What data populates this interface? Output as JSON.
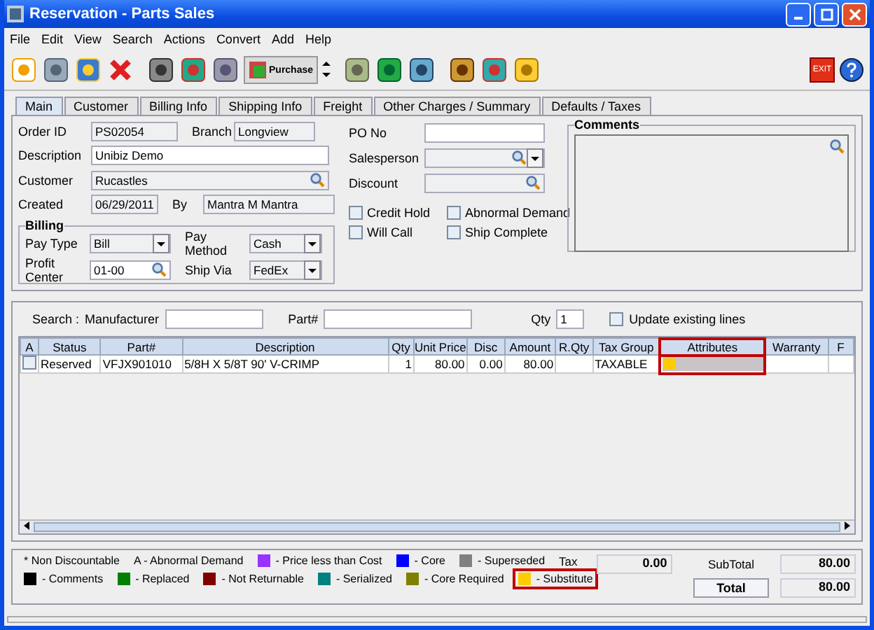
{
  "window": {
    "title": "Reservation - Parts Sales"
  },
  "menu": [
    "File",
    "Edit",
    "View",
    "Search",
    "Actions",
    "Convert",
    "Add",
    "Help"
  ],
  "toolbar": {
    "purchase_label": "Purchase",
    "exit_label": "EXIT"
  },
  "tabs": [
    {
      "label": "Main",
      "selected": true
    },
    {
      "label": "Customer",
      "selected": false
    },
    {
      "label": "Billing Info",
      "selected": false
    },
    {
      "label": "Shipping Info",
      "selected": false
    },
    {
      "label": "Freight",
      "selected": false
    },
    {
      "label": "Other Charges / Summary",
      "selected": false
    },
    {
      "label": "Defaults / Taxes",
      "selected": false
    }
  ],
  "order": {
    "order_id": {
      "label": "Order ID",
      "value": "PS02054"
    },
    "branch": {
      "label": "Branch",
      "value": "Longview"
    },
    "description": {
      "label": "Description",
      "value": "Unibiz Demo"
    },
    "customer": {
      "label": "Customer",
      "value": "Rucastles"
    },
    "created": {
      "label": "Created",
      "value": "06/29/2011"
    },
    "by": {
      "label": "By",
      "value": "Mantra M Mantra"
    },
    "po_no": {
      "label": "PO No"
    },
    "salesperson": {
      "label": "Salesperson"
    },
    "discount": {
      "label": "Discount"
    }
  },
  "flags": [
    {
      "label": "Credit Hold",
      "checked": false
    },
    {
      "label": "Abnormal Demand",
      "checked": false
    },
    {
      "label": "Will Call",
      "checked": false
    },
    {
      "label": "Ship Complete",
      "checked": false
    }
  ],
  "billing": {
    "title": "Billing",
    "pay_type": {
      "label": "Pay Type",
      "value": "Bill"
    },
    "pay_method": {
      "label": "Pay Method",
      "value": "Cash"
    },
    "profit_center": {
      "label": "Profit Center",
      "value": "01-00"
    },
    "ship_via": {
      "label": "Ship Via",
      "value": "FedEx"
    }
  },
  "comments": {
    "title": "Comments"
  },
  "search": {
    "label": "Search :",
    "manufacturer_label": "Manufacturer",
    "part_label": "Part#",
    "qty_label": "Qty",
    "qty_value": "1",
    "update_label": "Update existing lines",
    "update_checked": false
  },
  "table": {
    "columns": [
      {
        "label": "A",
        "highlighted": false
      },
      {
        "label": "Status",
        "highlighted": false
      },
      {
        "label": "Part#",
        "highlighted": false
      },
      {
        "label": "Description",
        "highlighted": false
      },
      {
        "label": "Qty",
        "highlighted": false
      },
      {
        "label": "Unit Price",
        "highlighted": false
      },
      {
        "label": "Disc",
        "highlighted": false
      },
      {
        "label": "Amount",
        "highlighted": false
      },
      {
        "label": "R.Qty",
        "highlighted": false
      },
      {
        "label": "Tax Group",
        "highlighted": false
      },
      {
        "label": "Attributes",
        "highlighted": true
      },
      {
        "label": "Warranty",
        "highlighted": false
      },
      {
        "label": "F",
        "highlighted": false
      }
    ],
    "rows": [
      {
        "checked": false,
        "status": "Reserved",
        "part": "VFJX901010",
        "description": "5/8H X 5/8T 90' V-CRIMP",
        "qty": "1",
        "unit_price": "80.00",
        "disc": "0.00",
        "amount": "80.00",
        "tax_group": "TAXABLE",
        "color": "#ffcc00"
      }
    ]
  },
  "legend": [
    {
      "kind": "text",
      "text": "* Non Discountable",
      "highlighted": false
    },
    {
      "kind": "text",
      "text": "A - Abnormal Demand",
      "highlighted": false
    },
    {
      "kind": "swatch",
      "color": "#9933ff",
      "text": "- Price less than Cost",
      "highlighted": false
    },
    {
      "kind": "swatch",
      "color": "#0000ff",
      "text": "- Core",
      "highlighted": false
    },
    {
      "kind": "swatch",
      "color": "#808080",
      "text": "- Superseded",
      "highlighted": false
    },
    {
      "kind": "swatch",
      "color": "#000000",
      "text": "- Comments",
      "highlighted": false
    },
    {
      "kind": "swatch",
      "color": "#008000",
      "text": "- Replaced",
      "highlighted": false
    },
    {
      "kind": "swatch",
      "color": "#800000",
      "text": "- Not Returnable",
      "highlighted": false
    },
    {
      "kind": "swatch",
      "color": "#008080",
      "text": "- Serialized",
      "highlighted": false
    },
    {
      "kind": "swatch",
      "color": "#808000",
      "text": "- Core Required",
      "highlighted": false
    },
    {
      "kind": "swatch",
      "color": "#ffcc00",
      "text": "- Substitute",
      "highlighted": true
    }
  ],
  "totals": {
    "tax_label": "Tax",
    "tax_value": "0.00",
    "subtotal_label": "SubTotal",
    "subtotal_value": "80.00",
    "total_label": "Total",
    "total_value": "80.00"
  }
}
